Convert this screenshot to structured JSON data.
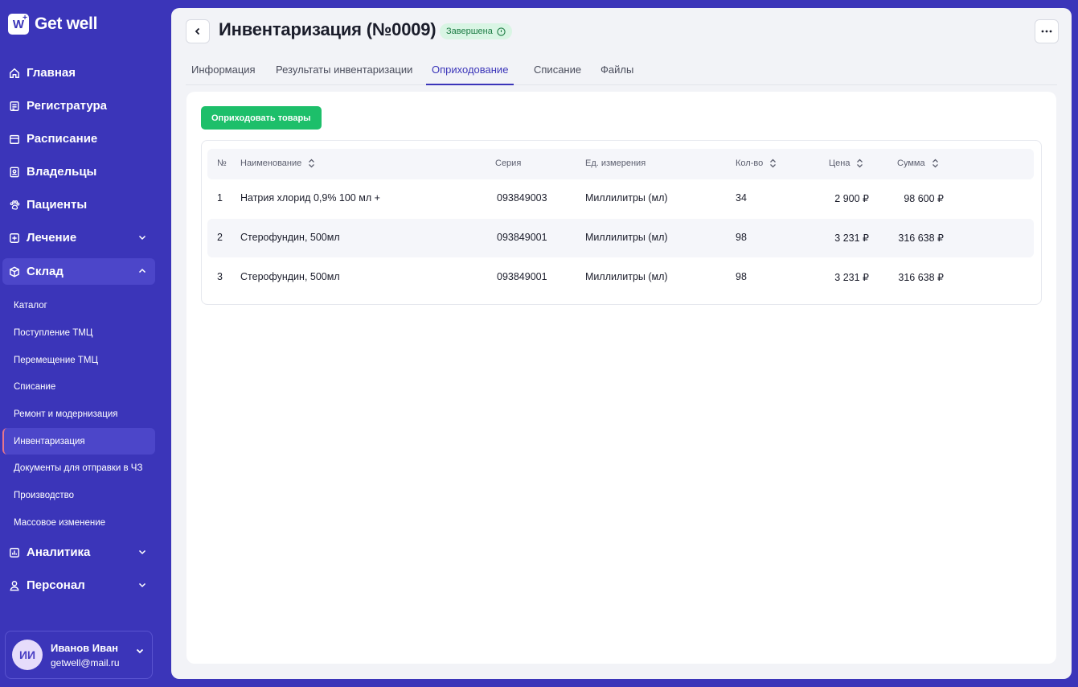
{
  "brand": {
    "logo_letter": "W",
    "name": "Get well"
  },
  "sidebar": {
    "items": [
      {
        "label": "Главная",
        "icon": "home-icon"
      },
      {
        "label": "Регистратура",
        "icon": "clipboard-icon"
      },
      {
        "label": "Расписание",
        "icon": "calendar-icon"
      },
      {
        "label": "Владельцы",
        "icon": "contacts-icon"
      },
      {
        "label": "Пациенты",
        "icon": "paw-icon"
      },
      {
        "label": "Лечение",
        "icon": "plus-square-icon"
      },
      {
        "label": "Склад",
        "icon": "box-icon"
      },
      {
        "label": "Аналитика",
        "icon": "chart-icon"
      },
      {
        "label": "Персонал",
        "icon": "person-icon"
      }
    ],
    "subitems": [
      "Каталог",
      "Поступление ТМЦ",
      "Перемещение ТМЦ",
      "Списание",
      "Ремонт и модернизация",
      "Инвентаризация",
      "Документы для отправки в ЧЗ",
      "Производство",
      "Массовое изменение"
    ]
  },
  "user": {
    "initials": "ИИ",
    "name": "Иванов Иван",
    "email": "getwell@mail.ru"
  },
  "header": {
    "title": "Инвентаризация (№0009)",
    "status": "Завершена"
  },
  "tabs": [
    "Информация",
    "Результаты инвентаризации",
    "Оприходование",
    "Списание",
    "Файлы"
  ],
  "actions": {
    "receive_button": "Оприходовать товары"
  },
  "table": {
    "headers": {
      "num": "№",
      "name": "Наименование",
      "series": "Серия",
      "unit": "Ед. измерения",
      "qty": "Кол-во",
      "price": "Цена",
      "sum": "Сумма"
    },
    "rows": [
      {
        "num": "1",
        "name": "Натрия хлорид 0,9% 100 мл +",
        "series": "093849003",
        "unit": "Миллилитры (мл)",
        "qty": "34",
        "price": "2 900 ₽",
        "sum": "98 600 ₽"
      },
      {
        "num": "2",
        "name": "Стерофундин, 500мл",
        "series": "093849001",
        "unit": "Миллилитры (мл)",
        "qty": "98",
        "price": "3 231 ₽",
        "sum": "316 638 ₽"
      },
      {
        "num": "3",
        "name": "Стерофундин, 500мл",
        "series": "093849001",
        "unit": "Миллилитры (мл)",
        "qty": "98",
        "price": "3 231 ₽",
        "sum": "316 638 ₽"
      }
    ]
  }
}
